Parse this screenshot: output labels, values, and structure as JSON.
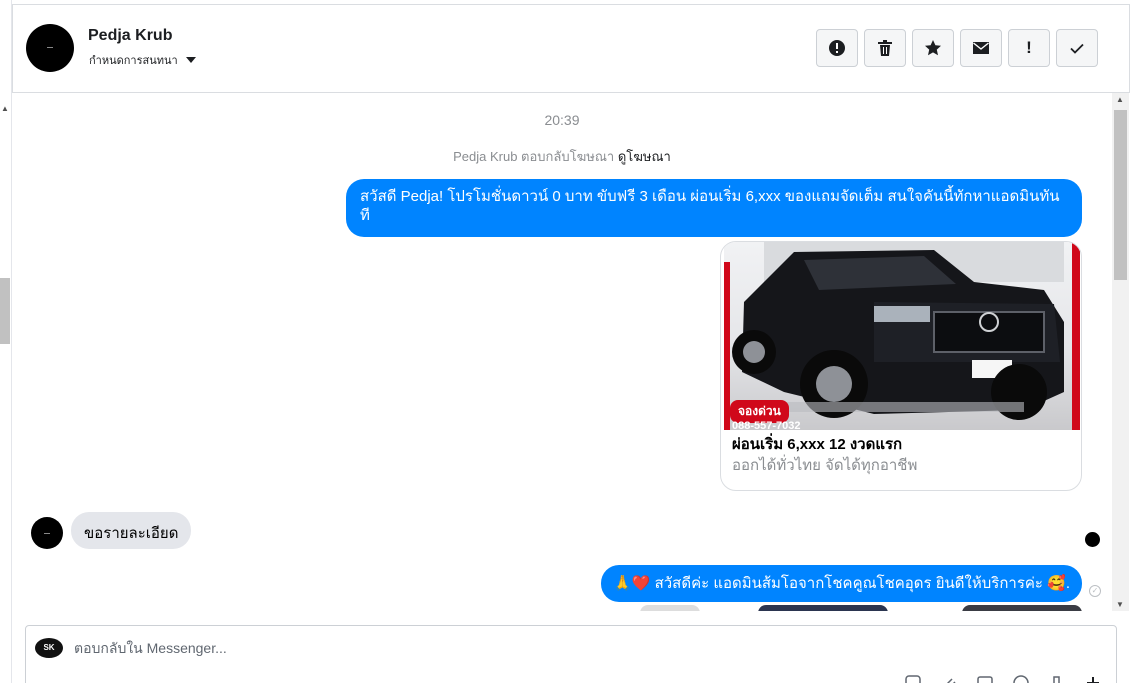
{
  "header": {
    "contact_name": "Pedja Krub",
    "assign_label": "กำหนดการสนทนา",
    "actions": [
      {
        "name": "report-spam-button",
        "icon": "alert-circle-icon"
      },
      {
        "name": "delete-button",
        "icon": "trash-icon"
      },
      {
        "name": "star-button",
        "icon": "star-icon"
      },
      {
        "name": "mark-unread-button",
        "icon": "envelope-icon"
      },
      {
        "name": "follow-up-button",
        "icon": "exclamation-icon",
        "label": "!"
      },
      {
        "name": "done-button",
        "icon": "check-icon"
      }
    ]
  },
  "chat": {
    "timestamp": "20:39",
    "ad_reply_text": "Pedja Krub ตอบกลับโฆษณา",
    "ad_link": "ดูโฆษณา",
    "messages": [
      {
        "from": "page",
        "text": "สวัสดี Pedja! โปรโมชั่นดาวน์ 0 บาท ขับฟรี 3 เดือน ผ่อนเริ่ม 6,xxx ของแถมจัดเต็ม สนใจคันนี้ทักหาแอดมินทันที"
      },
      {
        "from": "page",
        "type": "card",
        "image_badge": "จองด่วน",
        "image_phone": "088-557-7032",
        "title": "ผ่อนเริ่ม 6,xxx 12 งวดแรก",
        "subtitle": "ออกได้ทั่วไทย จัดได้ทุกอาชีพ"
      },
      {
        "from": "user",
        "text": "ขอรายละเอียด"
      },
      {
        "from": "page",
        "text": "🙏❤️ สวัสดีค่ะ แอดมินส้มโอจากโชคคูณโชคอุดร ยินดีให้บริการค่ะ 🥰."
      }
    ]
  },
  "composer": {
    "placeholder": "ตอบกลับใน Messenger...",
    "avatar_text": "SK"
  },
  "colors": {
    "bubble_out": "#0084ff",
    "bubble_in": "#e4e6eb",
    "promo_red": "#d0081a"
  }
}
